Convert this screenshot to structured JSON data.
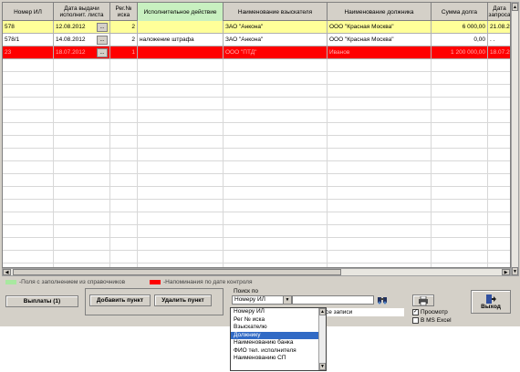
{
  "colors": {
    "row_selected": "#ffff99",
    "row_alert": "#ff0000",
    "legend_green": "#a8e8a0",
    "legend_red": "#ff0000"
  },
  "grid": {
    "headers": [
      "Номер ИЛ",
      "Дата выдачи исполнит. листа",
      "Рег.№ иска",
      "Исполнительное действие",
      "Наименование взыскателя",
      "Наименование должника",
      "Сумма долга",
      "Дата запроса"
    ],
    "rows": [
      {
        "num": "578",
        "date": "12.08.2012",
        "reg": "2",
        "action": "",
        "creditor": "ЗАО \"Анкона\"",
        "debtor": "ООО \"Красная Москва\"",
        "amount": "6 000,00",
        "req_date": "21.08.20",
        "style": "selected"
      },
      {
        "num": "578/1",
        "date": "14.08.2012",
        "reg": "2",
        "action": "наложение штрафа",
        "creditor": "ЗАО \"Анкона\"",
        "debtor": "ООО \"Красная Москва\"",
        "amount": "0,00",
        "req_date": ". .",
        "style": "normal"
      },
      {
        "num": "23",
        "date": "18.07.2012",
        "reg": "1",
        "action": "",
        "creditor": "ООО \"ПТД\"",
        "debtor": "Иванов",
        "amount": "1 200 000,00",
        "req_date": "18.07.20",
        "style": "alert"
      }
    ],
    "row_button": "..."
  },
  "legend": {
    "green_text": "-Поля с заполнением из справочников",
    "red_text": "-Напоминания по дате контроля"
  },
  "buttons": {
    "payments": "Выплаты (1)",
    "add_item": "Добавить пункт",
    "delete_item": "Удалить пункт",
    "exit": "Выход"
  },
  "search": {
    "label": "Поиск по",
    "selected": "Номеру ИЛ",
    "all_records": "се записи",
    "options": [
      "Номеру ИЛ",
      "Рег № иска",
      "Взыскателю",
      "Должнику",
      "Наименованию банка",
      "ФИО тел. исполнителя",
      "Наименованию СП"
    ],
    "highlighted_index": 3
  },
  "options": {
    "preview": "Просмотр",
    "excel": "В MS Excel",
    "preview_checked": true,
    "excel_checked": false
  }
}
